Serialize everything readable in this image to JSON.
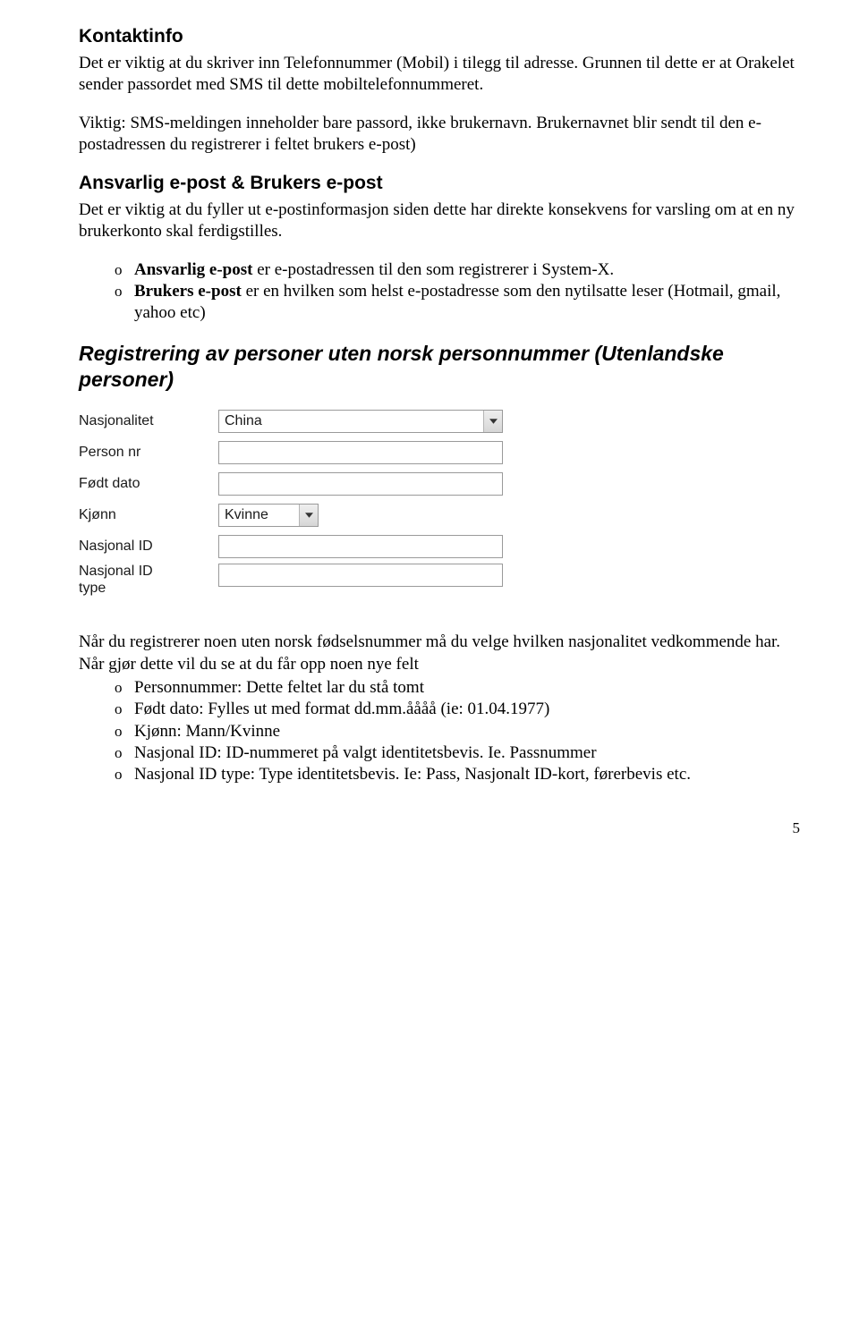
{
  "section1": {
    "heading": "Kontaktinfo",
    "p1": "Det er viktig at du skriver inn Telefonnummer (Mobil) i tilegg til adresse. Grunnen til dette er at Orakelet sender passordet med SMS til dette mobiltelefonnummeret.",
    "p2": "Viktig: SMS-meldingen inneholder bare passord, ikke brukernavn. Brukernavnet blir sendt til den e-postadressen du registrerer i feltet brukers e-post)"
  },
  "section2": {
    "heading": "Ansvarlig e-post & Brukers e-post",
    "p1": "Det er viktig at du fyller ut e-postinformasjon siden dette har direkte konsekvens for varsling om at en ny brukerkonto skal ferdigstilles.",
    "b1a": "Ansvarlig e-post",
    "b1b": " er e-postadressen til den som registrerer i System-X.",
    "b2a": "Brukers e-post",
    "b2b": " er en hvilken som helst e-postadresse som den nytilsatte leser (Hotmail, gmail, yahoo etc)"
  },
  "section3": {
    "heading": "Registrering av personer uten norsk personnummer (Utenlandske personer)",
    "form": {
      "l1": "Nasjonalitet",
      "v1": "China",
      "l2": "Person nr",
      "l3": "Født dato",
      "l4": "Kjønn",
      "v4": "Kvinne",
      "l5": "Nasjonal ID",
      "l6a": "Nasjonal ID",
      "l6b": "type"
    },
    "p1": "Når du registrerer noen uten norsk fødselsnummer må du velge hvilken nasjonalitet vedkommende har. Når gjør dette vil du se at du får opp noen nye felt",
    "b1": "Personnummer: Dette feltet lar du stå tomt",
    "b2": "Født dato: Fylles ut med format dd.mm.åååå (ie: 01.04.1977)",
    "b3": "Kjønn: Mann/Kvinne",
    "b4": "Nasjonal ID: ID-nummeret på valgt identitetsbevis. Ie. Passnummer",
    "b5": "Nasjonal ID type: Type identitetsbevis. Ie: Pass, Nasjonalt ID-kort, førerbevis etc."
  },
  "ring": "o",
  "pagenum": "5"
}
